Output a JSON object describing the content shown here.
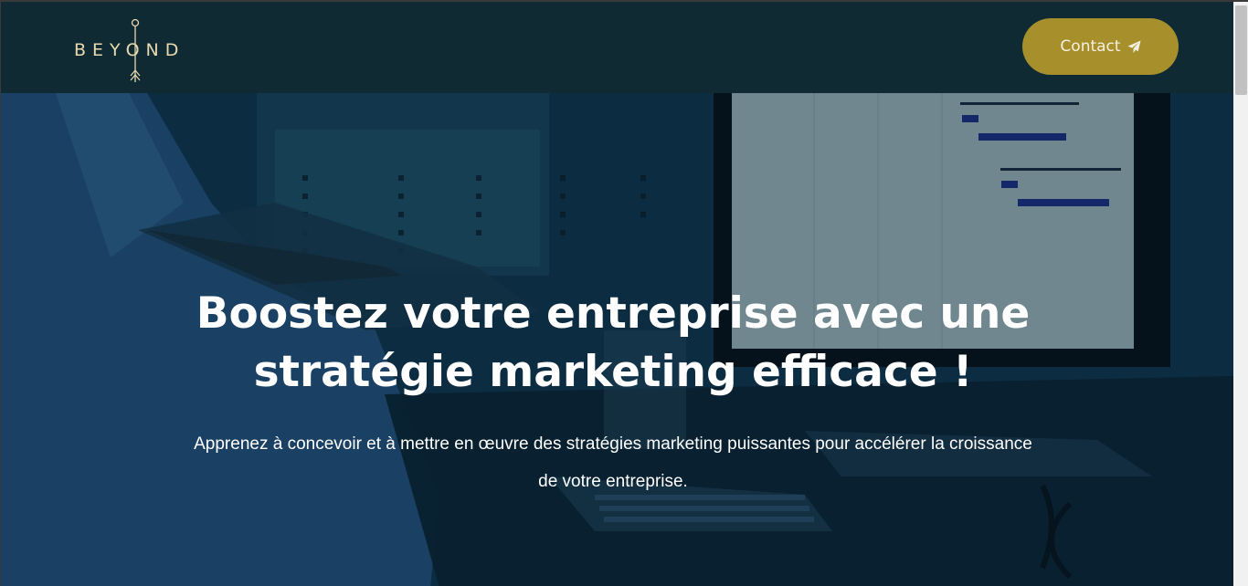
{
  "header": {
    "logo_text": "BEYOND",
    "contact_label": "Contact"
  },
  "hero": {
    "title": "Boostez votre entreprise avec une stratégie marketing efficace !",
    "subtitle": "Apprenez à concevoir et à mettre en œuvre des stratégies marketing puissantes pour accélérer la croissance de votre entreprise."
  },
  "colors": {
    "header_bg": "#0f2a33",
    "accent_button": "#a78f2c",
    "logo_color": "#e8d9b0",
    "text_white": "#ffffff"
  },
  "icons": {
    "contact_icon": "paper-plane-icon",
    "logo_icon": "arrow-logo-icon"
  }
}
